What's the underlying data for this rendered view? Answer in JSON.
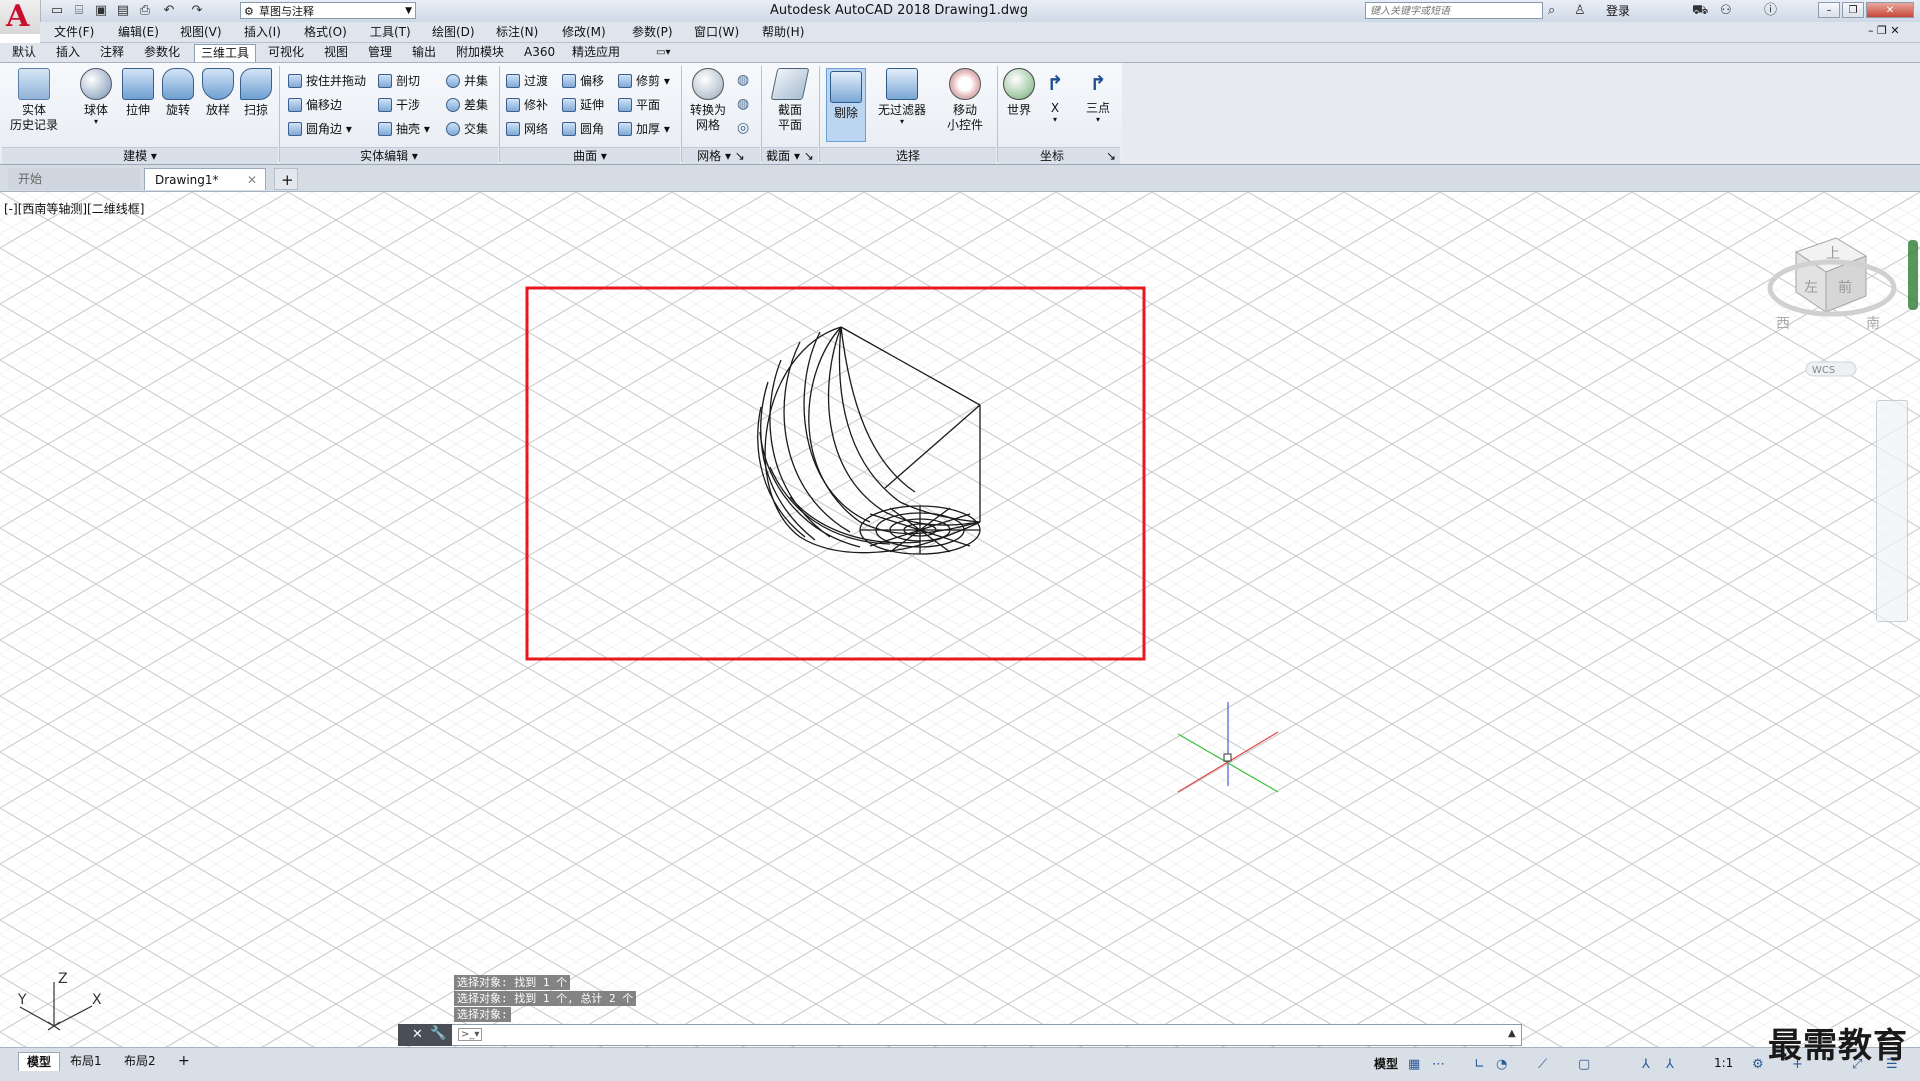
{
  "app": {
    "logo": "A",
    "window_title": "Autodesk AutoCAD 2018    Drawing1.dwg",
    "workspace": "草图与注释",
    "search_placeholder": "键入关键字或短语",
    "login": "登录"
  },
  "menu": [
    "文件(F)",
    "编辑(E)",
    "视图(V)",
    "插入(I)",
    "格式(O)",
    "工具(T)",
    "绘图(D)",
    "标注(N)",
    "修改(M)",
    "参数(P)",
    "窗口(W)",
    "帮助(H)"
  ],
  "ribbon_tabs": [
    "默认",
    "插入",
    "注释",
    "参数化",
    "三维工具",
    "可视化",
    "视图",
    "管理",
    "输出",
    "附加模块",
    "A360",
    "精选应用"
  ],
  "ribbon_active_tab": "三维工具",
  "panels": {
    "modeling": {
      "title": "建模",
      "history": [
        "实体",
        "历史记录"
      ],
      "buttons": [
        "球体",
        "拉伸",
        "旋转",
        "放样",
        "扫掠"
      ]
    },
    "solid_edit": {
      "title": "实体编辑",
      "col1": [
        "按住并拖动",
        "偏移边",
        "圆角边"
      ],
      "col2": [
        "剖切",
        "干涉",
        "抽壳"
      ],
      "col3": [
        "并集",
        "差集",
        "交集"
      ]
    },
    "surface": {
      "title": "曲面",
      "col1": [
        "过渡",
        "修补",
        "网络"
      ],
      "col2": [
        "偏移",
        "延伸",
        "圆角"
      ],
      "col3": [
        "修剪",
        "平面",
        "加厚"
      ]
    },
    "mesh": {
      "title": "网格",
      "convert": [
        "转换为",
        "网格"
      ]
    },
    "section": {
      "title": "截面",
      "plane": [
        "截面",
        "平面"
      ]
    },
    "selection": {
      "title": "选择",
      "cull": "剔除",
      "filter": "无过滤器",
      "gizmo": [
        "移动",
        "小控件"
      ]
    },
    "coordinates": {
      "title": "坐标",
      "world": "世界",
      "x": "X",
      "three_point": "三点"
    }
  },
  "doc_tabs": {
    "start": "开始",
    "drawing": "Drawing1*"
  },
  "viewport_label": "[-][西南等轴测][二维线框]",
  "viewcube": {
    "top": "上",
    "left": "左",
    "front": "前",
    "west": "西",
    "south": "南",
    "wcs": "WCS"
  },
  "ucs": {
    "x": "X",
    "y": "Y",
    "z": "Z"
  },
  "command_history": [
    "选择对象: 找到 1 个",
    "选择对象: 找到 1 个, 总计 2 个",
    "选择对象:"
  ],
  "layout_tabs": [
    "模型",
    "布局1",
    "布局2"
  ],
  "status": {
    "model": "模型",
    "scale": "1:1"
  },
  "watermark": "最需教育",
  "colors": {
    "highlight_box": "#e8191e",
    "accent": "#2a5a9a"
  }
}
